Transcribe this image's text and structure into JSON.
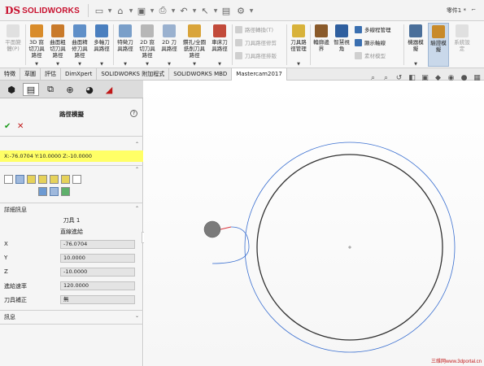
{
  "app": {
    "logo_mark": "DS",
    "logo_text": "SOLIDWORKS",
    "document_title": "零件1 *",
    "pin": "⌐"
  },
  "quick_access": [
    {
      "name": "new-document-icon",
      "glyph": "▭"
    },
    {
      "name": "open-icon",
      "glyph": "⌂"
    },
    {
      "name": "save-icon",
      "glyph": "▣"
    },
    {
      "name": "print-icon",
      "glyph": "⎙"
    },
    {
      "name": "undo-icon",
      "glyph": "↶"
    },
    {
      "name": "select-icon",
      "glyph": "↖"
    },
    {
      "name": "rebuild-icon",
      "glyph": "▤"
    },
    {
      "name": "options-icon",
      "glyph": "⚙"
    }
  ],
  "ribbon": {
    "buttons": [
      {
        "id": "b0",
        "label": "平面變\n體(P)",
        "disabled": true,
        "color": "#bdbdbd"
      },
      {
        "id": "b1",
        "label": "3D 窩\n切刀具\n路徑",
        "disabled": false,
        "color": "#d98c2b"
      },
      {
        "id": "b2",
        "label": "曲面粗\n切刀具\n路徑",
        "disabled": false,
        "color": "#c97a2a"
      },
      {
        "id": "b3",
        "label": "曲面精\n修刀具\n路徑",
        "disabled": false,
        "color": "#5f8fc8"
      },
      {
        "id": "b4",
        "label": "多軸刀\n具路徑",
        "disabled": false,
        "color": "#4a7fbf"
      },
      {
        "id": "b5",
        "label": "特徵刀\n具路徑",
        "disabled": false,
        "color": "#7a9fc9"
      },
      {
        "id": "b6",
        "label": "2D 窩\n切刀具\n路徑",
        "disabled": false,
        "color": "#b7b7b7"
      },
      {
        "id": "b7",
        "label": "2D 刀\n具路徑",
        "disabled": false,
        "color": "#9ab1cf"
      },
      {
        "id": "b8",
        "label": "鑽孔/全圓\n銑削刀具\n路徑",
        "disabled": false,
        "color": "#d9a43a"
      },
      {
        "id": "b9",
        "label": "車床刀\n具路徑",
        "disabled": false,
        "color": "#c24a3a"
      },
      {
        "id": "b10",
        "label": "刀具路\n徑管理",
        "disabled": false,
        "color": "#d8b23a"
      },
      {
        "id": "b11",
        "label": "輪廓邊\n界",
        "disabled": false,
        "color": "#8a5a2a"
      },
      {
        "id": "b12",
        "label": "智慧視\n角",
        "disabled": false,
        "color": "#2f5f9f"
      },
      {
        "id": "b13",
        "label": "機器模\n擬",
        "disabled": false,
        "color": "#4a6f9a"
      },
      {
        "id": "b14",
        "label": "驗證模\n擬",
        "disabled": false,
        "color": "#c88a2a"
      },
      {
        "id": "b15",
        "label": "系統設\n定",
        "disabled": true,
        "color": "#bdbdbd"
      }
    ],
    "small": [
      {
        "id": "s0",
        "label": "路徑轉換(T)",
        "enabled": false
      },
      {
        "id": "s1",
        "label": "刀具路徑修剪",
        "enabled": false
      },
      {
        "id": "s2",
        "label": "刀具路徑排版",
        "enabled": false
      },
      {
        "id": "s3",
        "label": "多線程管理",
        "enabled": true
      },
      {
        "id": "s4",
        "label": "顯示軸線",
        "enabled": true
      },
      {
        "id": "s5",
        "label": "素材模型",
        "enabled": false
      }
    ]
  },
  "tabs": [
    "特徵",
    "草圖",
    "評估",
    "DimXpert",
    "SOLIDWORKS 附加程式",
    "SOLIDWORKS MBD",
    "Mastercam2017"
  ],
  "active_tab": "Mastercam2017",
  "panel": {
    "title": "路徑模擬",
    "help": "?",
    "ok": "✔",
    "cancel": "✕",
    "coords": "X:-76.0704   Y:10.0000  Z:-10.0000",
    "detail_title": "詳細訊息",
    "tool_label": "刀具 1",
    "move_label": "直線進給",
    "fields": [
      {
        "label": "X",
        "value": "-76.0704"
      },
      {
        "label": "Y",
        "value": "10.0000"
      },
      {
        "label": "Z",
        "value": "-10.0000"
      },
      {
        "label": "進給速率",
        "value": "120.0000"
      },
      {
        "label": "刀具補正",
        "value": "無"
      }
    ],
    "info_title": "訊息"
  },
  "watermark": "三维网www.3dportal.cn"
}
